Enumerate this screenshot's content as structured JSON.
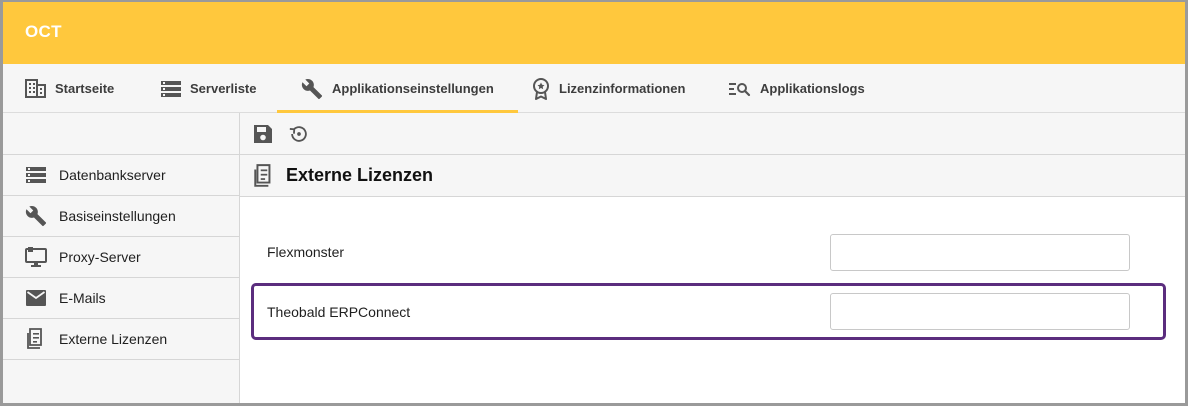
{
  "app": {
    "title": "OCT"
  },
  "tabs": [
    {
      "label": "Startseite",
      "icon": "building-icon"
    },
    {
      "label": "Serverliste",
      "icon": "server-list-icon"
    },
    {
      "label": "Applikationseinstellungen",
      "icon": "wrench-icon",
      "active": true
    },
    {
      "label": "Lizenzinformationen",
      "icon": "award-badge-icon"
    },
    {
      "label": "Applikationslogs",
      "icon": "list-search-icon"
    }
  ],
  "sidebar": {
    "items": [
      {
        "label": "Datenbankserver",
        "icon": "server-list-icon"
      },
      {
        "label": "Basiseinstellungen",
        "icon": "wrench-icon"
      },
      {
        "label": "Proxy-Server",
        "icon": "monitor-icon"
      },
      {
        "label": "E-Mails",
        "icon": "envelope-icon"
      },
      {
        "label": "Externe Lizenzen",
        "icon": "license-document-icon",
        "active": true
      }
    ]
  },
  "toolbar": {
    "save_icon": "save-icon",
    "reset_icon": "history-icon"
  },
  "section": {
    "title": "Externe Lizenzen",
    "fields": [
      {
        "label": "Flexmonster",
        "value": ""
      },
      {
        "label": "Theobald ERPConnect",
        "value": "",
        "highlighted": true
      }
    ]
  },
  "colors": {
    "header": "#ffc83d",
    "highlight_border": "#5b2d7e",
    "panel": "#f6f6f6"
  }
}
